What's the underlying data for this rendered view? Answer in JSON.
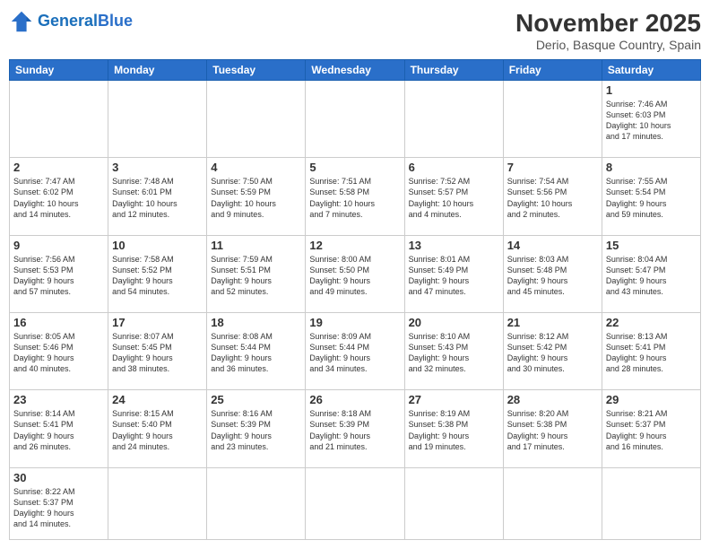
{
  "header": {
    "logo_general": "General",
    "logo_blue": "Blue",
    "month_title": "November 2025",
    "location": "Derio, Basque Country, Spain"
  },
  "days_of_week": [
    "Sunday",
    "Monday",
    "Tuesday",
    "Wednesday",
    "Thursday",
    "Friday",
    "Saturday"
  ],
  "weeks": [
    [
      {
        "day": "",
        "data": ""
      },
      {
        "day": "",
        "data": ""
      },
      {
        "day": "",
        "data": ""
      },
      {
        "day": "",
        "data": ""
      },
      {
        "day": "",
        "data": ""
      },
      {
        "day": "",
        "data": ""
      },
      {
        "day": "1",
        "data": "Sunrise: 7:46 AM\nSunset: 6:03 PM\nDaylight: 10 hours\nand 17 minutes."
      }
    ],
    [
      {
        "day": "2",
        "data": "Sunrise: 7:47 AM\nSunset: 6:02 PM\nDaylight: 10 hours\nand 14 minutes."
      },
      {
        "day": "3",
        "data": "Sunrise: 7:48 AM\nSunset: 6:01 PM\nDaylight: 10 hours\nand 12 minutes."
      },
      {
        "day": "4",
        "data": "Sunrise: 7:50 AM\nSunset: 5:59 PM\nDaylight: 10 hours\nand 9 minutes."
      },
      {
        "day": "5",
        "data": "Sunrise: 7:51 AM\nSunset: 5:58 PM\nDaylight: 10 hours\nand 7 minutes."
      },
      {
        "day": "6",
        "data": "Sunrise: 7:52 AM\nSunset: 5:57 PM\nDaylight: 10 hours\nand 4 minutes."
      },
      {
        "day": "7",
        "data": "Sunrise: 7:54 AM\nSunset: 5:56 PM\nDaylight: 10 hours\nand 2 minutes."
      },
      {
        "day": "8",
        "data": "Sunrise: 7:55 AM\nSunset: 5:54 PM\nDaylight: 9 hours\nand 59 minutes."
      }
    ],
    [
      {
        "day": "9",
        "data": "Sunrise: 7:56 AM\nSunset: 5:53 PM\nDaylight: 9 hours\nand 57 minutes."
      },
      {
        "day": "10",
        "data": "Sunrise: 7:58 AM\nSunset: 5:52 PM\nDaylight: 9 hours\nand 54 minutes."
      },
      {
        "day": "11",
        "data": "Sunrise: 7:59 AM\nSunset: 5:51 PM\nDaylight: 9 hours\nand 52 minutes."
      },
      {
        "day": "12",
        "data": "Sunrise: 8:00 AM\nSunset: 5:50 PM\nDaylight: 9 hours\nand 49 minutes."
      },
      {
        "day": "13",
        "data": "Sunrise: 8:01 AM\nSunset: 5:49 PM\nDaylight: 9 hours\nand 47 minutes."
      },
      {
        "day": "14",
        "data": "Sunrise: 8:03 AM\nSunset: 5:48 PM\nDaylight: 9 hours\nand 45 minutes."
      },
      {
        "day": "15",
        "data": "Sunrise: 8:04 AM\nSunset: 5:47 PM\nDaylight: 9 hours\nand 43 minutes."
      }
    ],
    [
      {
        "day": "16",
        "data": "Sunrise: 8:05 AM\nSunset: 5:46 PM\nDaylight: 9 hours\nand 40 minutes."
      },
      {
        "day": "17",
        "data": "Sunrise: 8:07 AM\nSunset: 5:45 PM\nDaylight: 9 hours\nand 38 minutes."
      },
      {
        "day": "18",
        "data": "Sunrise: 8:08 AM\nSunset: 5:44 PM\nDaylight: 9 hours\nand 36 minutes."
      },
      {
        "day": "19",
        "data": "Sunrise: 8:09 AM\nSunset: 5:44 PM\nDaylight: 9 hours\nand 34 minutes."
      },
      {
        "day": "20",
        "data": "Sunrise: 8:10 AM\nSunset: 5:43 PM\nDaylight: 9 hours\nand 32 minutes."
      },
      {
        "day": "21",
        "data": "Sunrise: 8:12 AM\nSunset: 5:42 PM\nDaylight: 9 hours\nand 30 minutes."
      },
      {
        "day": "22",
        "data": "Sunrise: 8:13 AM\nSunset: 5:41 PM\nDaylight: 9 hours\nand 28 minutes."
      }
    ],
    [
      {
        "day": "23",
        "data": "Sunrise: 8:14 AM\nSunset: 5:41 PM\nDaylight: 9 hours\nand 26 minutes."
      },
      {
        "day": "24",
        "data": "Sunrise: 8:15 AM\nSunset: 5:40 PM\nDaylight: 9 hours\nand 24 minutes."
      },
      {
        "day": "25",
        "data": "Sunrise: 8:16 AM\nSunset: 5:39 PM\nDaylight: 9 hours\nand 23 minutes."
      },
      {
        "day": "26",
        "data": "Sunrise: 8:18 AM\nSunset: 5:39 PM\nDaylight: 9 hours\nand 21 minutes."
      },
      {
        "day": "27",
        "data": "Sunrise: 8:19 AM\nSunset: 5:38 PM\nDaylight: 9 hours\nand 19 minutes."
      },
      {
        "day": "28",
        "data": "Sunrise: 8:20 AM\nSunset: 5:38 PM\nDaylight: 9 hours\nand 17 minutes."
      },
      {
        "day": "29",
        "data": "Sunrise: 8:21 AM\nSunset: 5:37 PM\nDaylight: 9 hours\nand 16 minutes."
      }
    ],
    [
      {
        "day": "30",
        "data": "Sunrise: 8:22 AM\nSunset: 5:37 PM\nDaylight: 9 hours\nand 14 minutes."
      },
      {
        "day": "",
        "data": ""
      },
      {
        "day": "",
        "data": ""
      },
      {
        "day": "",
        "data": ""
      },
      {
        "day": "",
        "data": ""
      },
      {
        "day": "",
        "data": ""
      },
      {
        "day": "",
        "data": ""
      }
    ]
  ]
}
